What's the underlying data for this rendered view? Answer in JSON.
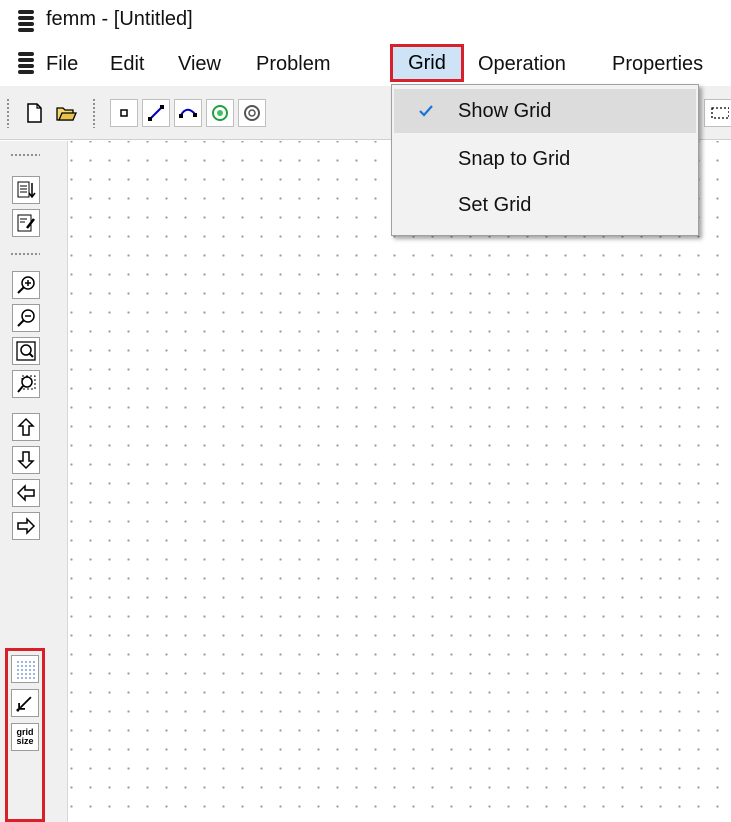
{
  "window": {
    "title": "femm - [Untitled]"
  },
  "menubar": {
    "items": [
      "File",
      "Edit",
      "View",
      "Problem",
      "Grid",
      "Operation",
      "Properties"
    ]
  },
  "grid_menu": {
    "items": [
      {
        "label": "Show Grid",
        "checked": true
      },
      {
        "label": "Snap to Grid",
        "checked": false
      },
      {
        "label": "Set Grid",
        "checked": false
      }
    ]
  },
  "toolbar": {
    "buttons": [
      "new-icon",
      "open-folder-icon",
      "node-icon",
      "segment-icon",
      "arc-icon",
      "block-label-icon",
      "group-icon"
    ]
  },
  "left_toolbar": {
    "buttons": [
      "analyze-icon",
      "view-results-icon",
      "zoom-in-icon",
      "zoom-out-icon",
      "zoom-natural-icon",
      "zoom-window-icon",
      "pan-up-icon",
      "pan-down-icon",
      "pan-left-icon",
      "pan-right-icon"
    ],
    "grid_group": {
      "buttons": [
        "show-grid-icon",
        "snap-to-grid-icon",
        "grid-size-icon"
      ],
      "grid_size_label_line1": "grid",
      "grid_size_label_line2": "size"
    }
  },
  "colors": {
    "highlight": "#d8202a",
    "menu_hover": "#cfe3f7",
    "check": "#1a73d8"
  }
}
